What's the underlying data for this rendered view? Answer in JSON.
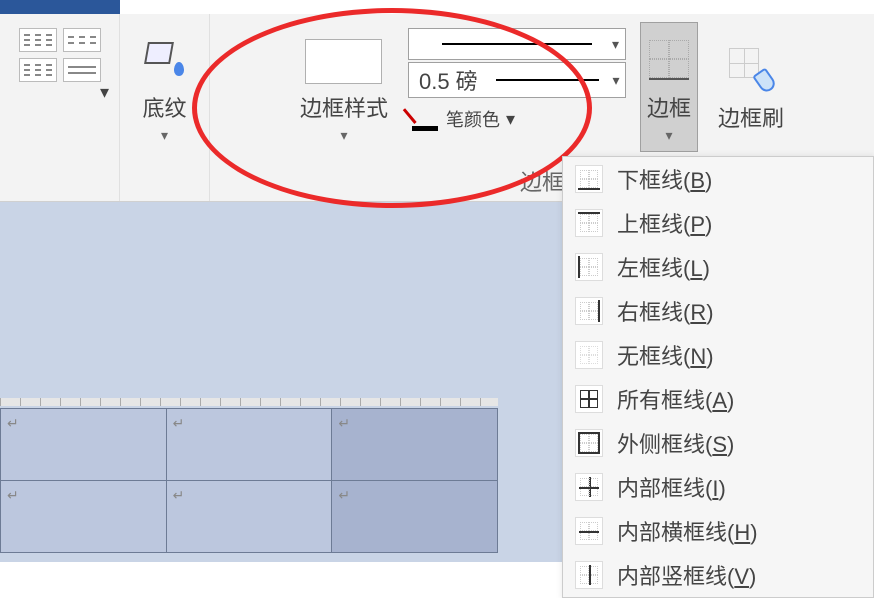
{
  "ribbon": {
    "shading_label": "底纹",
    "border_style_label": "边框样式",
    "line_weight_value": "0.5 磅",
    "pen_color_label": "笔颜色",
    "group_borders_label": "边框",
    "borders_button_label": "边框",
    "border_painter_label": "边框刷"
  },
  "menu": {
    "items": [
      {
        "text": "下框线",
        "accel": "B",
        "icon": "bottom"
      },
      {
        "text": "上框线",
        "accel": "P",
        "icon": "top"
      },
      {
        "text": "左框线",
        "accel": "L",
        "icon": "left"
      },
      {
        "text": "右框线",
        "accel": "R",
        "icon": "right"
      },
      {
        "text": "无框线",
        "accel": "N",
        "icon": "none"
      },
      {
        "text": "所有框线",
        "accel": "A",
        "icon": "all"
      },
      {
        "text": "外侧框线",
        "accel": "S",
        "icon": "outside"
      },
      {
        "text": "内部框线",
        "accel": "I",
        "icon": "inside"
      },
      {
        "text": "内部横框线",
        "accel": "H",
        "icon": "hinside"
      },
      {
        "text": "内部竖框线",
        "accel": "V",
        "icon": "vinside"
      }
    ]
  },
  "table": {
    "cell_marker": "↵"
  }
}
